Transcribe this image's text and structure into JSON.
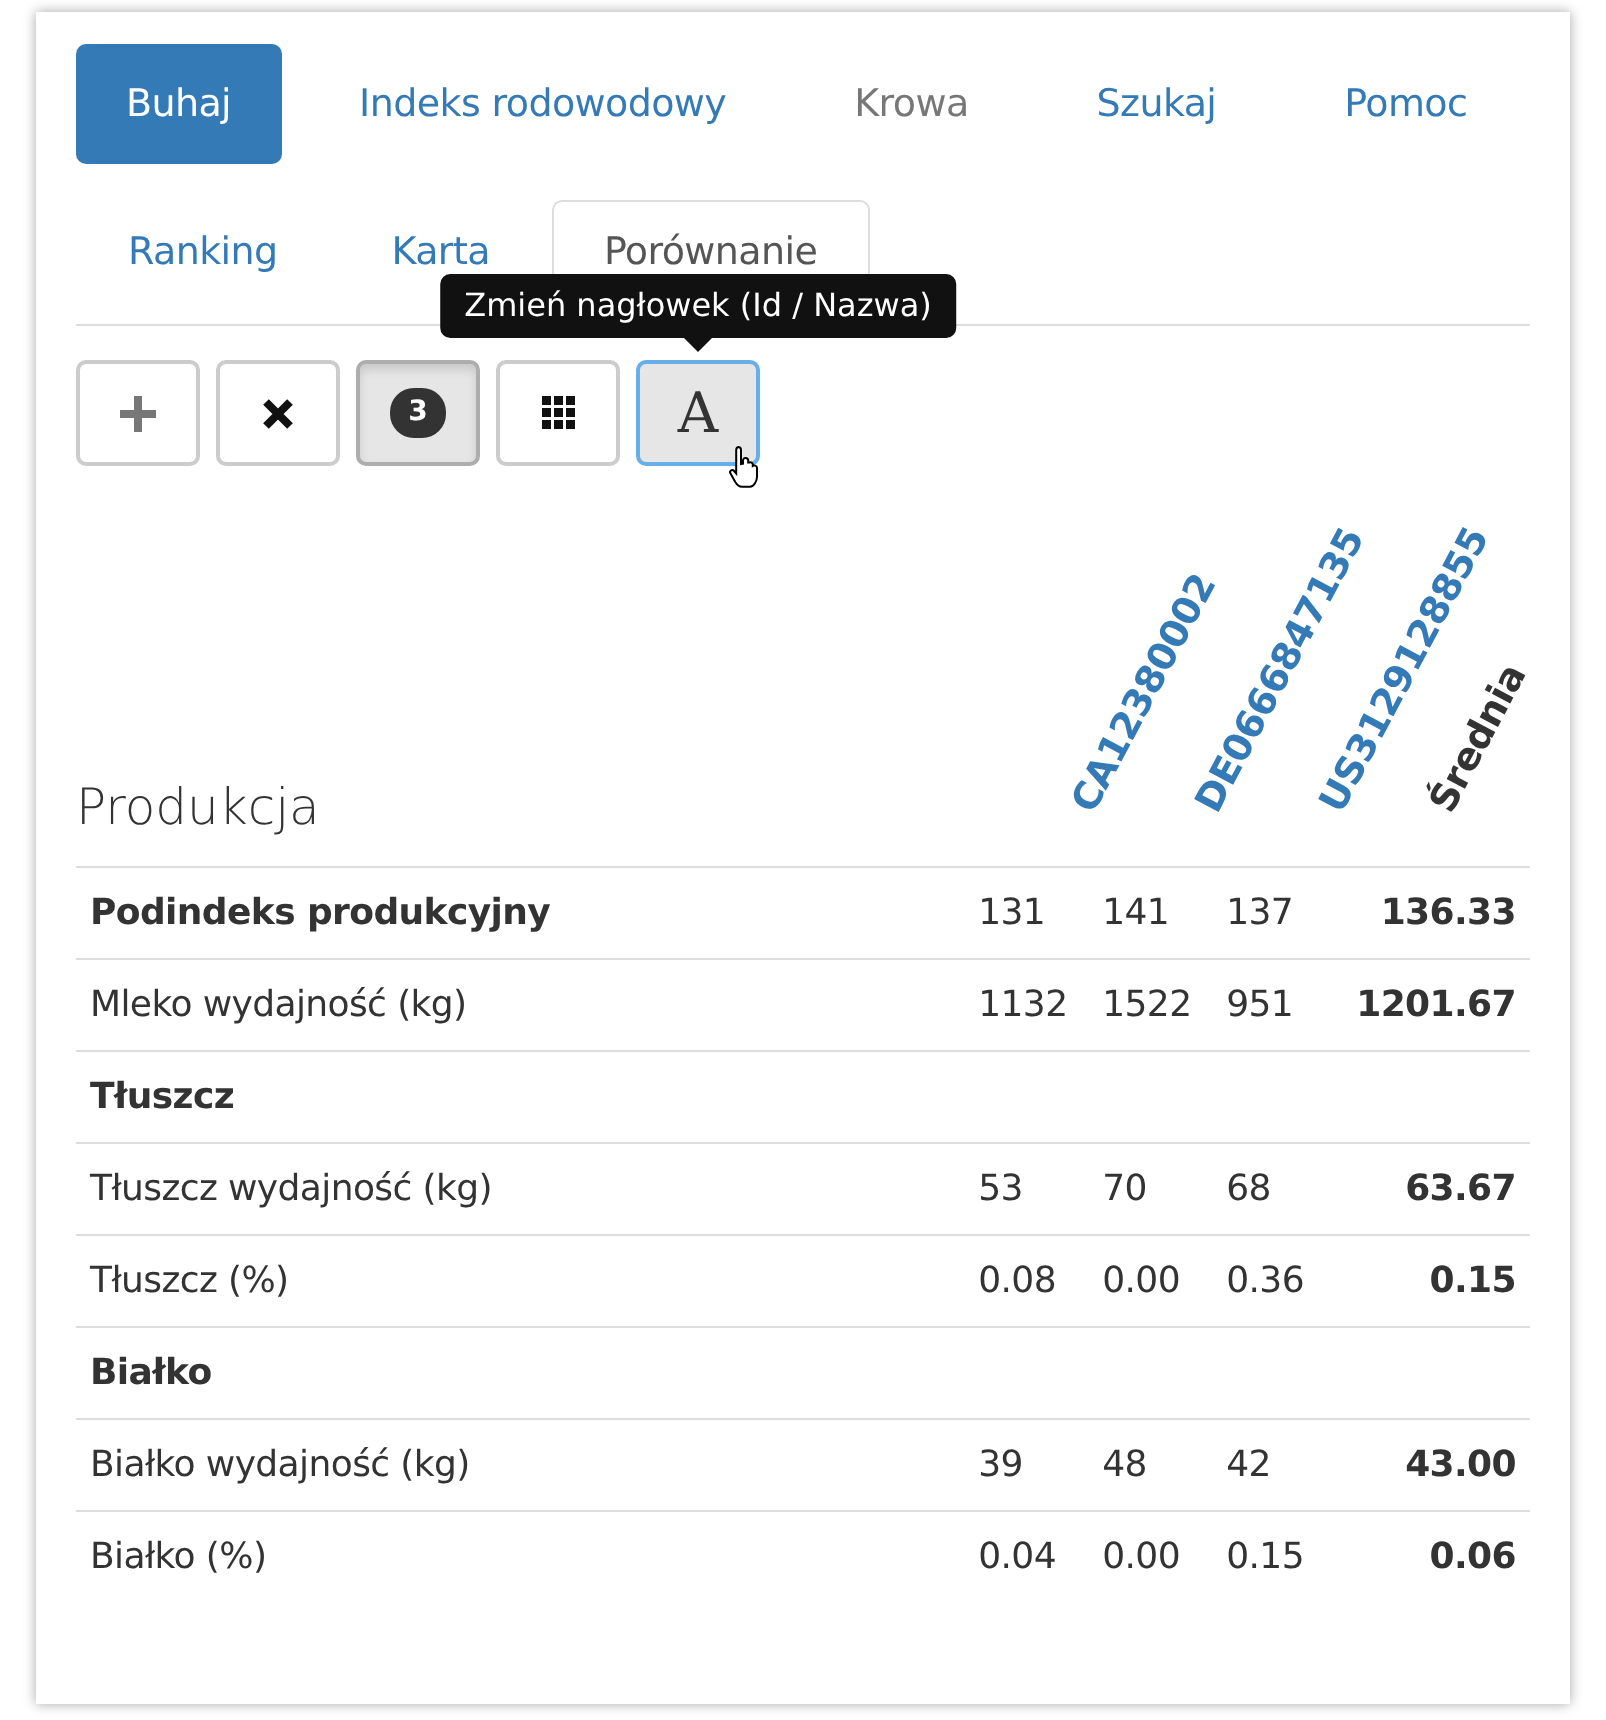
{
  "main_nav": [
    {
      "label": "Buhaj",
      "selected": true,
      "disabled": false
    },
    {
      "label": "Indeks rodowodowy",
      "selected": false,
      "disabled": false
    },
    {
      "label": "Krowa",
      "selected": false,
      "disabled": true
    },
    {
      "label": "Szukaj",
      "selected": false,
      "disabled": false
    },
    {
      "label": "Pomoc",
      "selected": false,
      "disabled": false
    }
  ],
  "sub_tabs": [
    {
      "label": "Ranking",
      "selected": false
    },
    {
      "label": "Karta",
      "selected": false
    },
    {
      "label": "Porównanie",
      "selected": true
    }
  ],
  "toolbar": [
    {
      "kind": "plus",
      "pressed": false,
      "focused": false
    },
    {
      "kind": "remove",
      "pressed": false,
      "focused": false
    },
    {
      "kind": "count",
      "text": "3",
      "pressed": true,
      "focused": false
    },
    {
      "kind": "grid",
      "pressed": false,
      "focused": false
    },
    {
      "kind": "letter",
      "text": "A",
      "pressed": false,
      "focused": true,
      "tooltip": "Zmień nagłowek (Id / Nazwa)"
    }
  ],
  "section_title": "Produkcja",
  "columns": [
    {
      "label": "CA12380002",
      "kind": "animal"
    },
    {
      "label": "DE0666847135",
      "kind": "animal"
    },
    {
      "label": "US3129128855",
      "kind": "animal"
    },
    {
      "label": "Średnia",
      "kind": "average"
    }
  ],
  "rows": [
    {
      "kind": "index",
      "label": "Podindeks produkcyjny",
      "values": [
        "131",
        "141",
        "137"
      ],
      "average": "136.33"
    },
    {
      "kind": "metric",
      "label": "Mleko wydajność (kg)",
      "values": [
        "1132",
        "1522",
        "951"
      ],
      "average": "1201.67"
    },
    {
      "kind": "section",
      "label": "Tłuszcz"
    },
    {
      "kind": "metric",
      "label": "Tłuszcz wydajność (kg)",
      "values": [
        "53",
        "70",
        "68"
      ],
      "average": "63.67"
    },
    {
      "kind": "metric",
      "label": "Tłuszcz (%)",
      "values": [
        "0.08",
        "0.00",
        "0.36"
      ],
      "average": "0.15"
    },
    {
      "kind": "section",
      "label": "Białko"
    },
    {
      "kind": "metric",
      "label": "Białko wydajność (kg)",
      "values": [
        "39",
        "48",
        "42"
      ],
      "average": "43.00"
    },
    {
      "kind": "metric",
      "label": "Białko (%)",
      "values": [
        "0.04",
        "0.00",
        "0.15"
      ],
      "average": "0.06"
    }
  ]
}
